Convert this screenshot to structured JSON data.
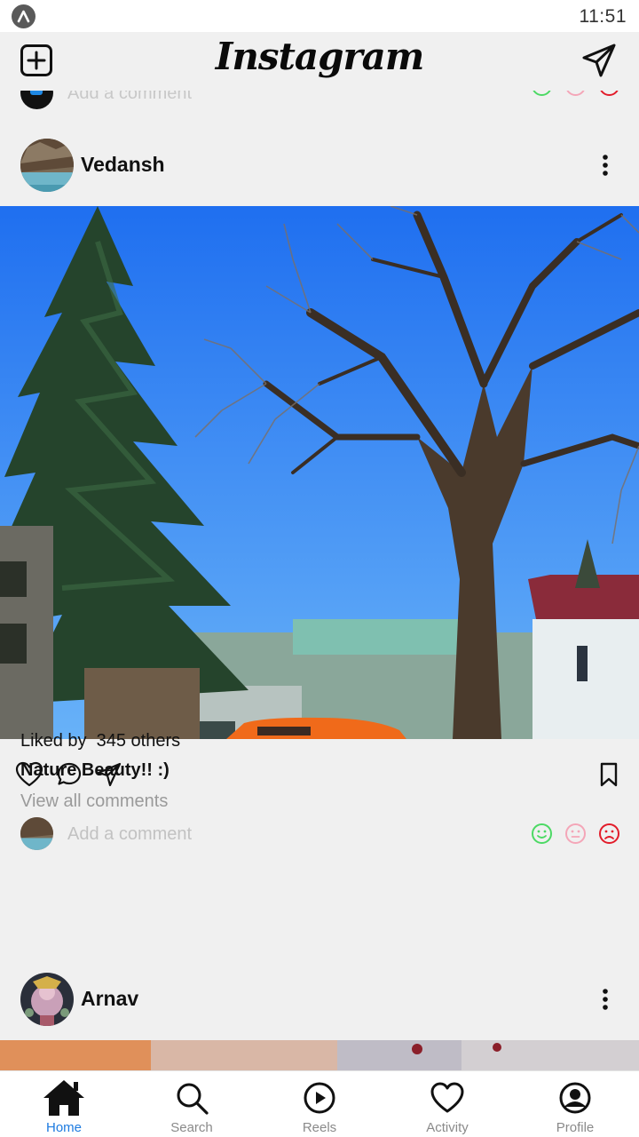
{
  "status_bar": {
    "time": "11:51"
  },
  "header": {
    "title": "Instagram",
    "new_post_icon": "plus-square-icon",
    "direct_icon": "paper-plane-icon"
  },
  "feed": {
    "previous_post": {
      "comment_placeholder": "Add a comment"
    },
    "posts": [
      {
        "username": "Vedansh",
        "likes_label": "Liked by",
        "likes_count": "345 others",
        "caption": "Nature Beauty!! :)",
        "view_comments": "View all comments",
        "comment_placeholder": "Add a comment",
        "reactions": [
          "happy-face-icon",
          "neutral-face-icon",
          "sad-face-icon"
        ]
      },
      {
        "username": "Arnav"
      }
    ]
  },
  "bottom_nav": {
    "items": [
      {
        "label": "Home",
        "icon": "home-icon",
        "active": true
      },
      {
        "label": "Search",
        "icon": "search-icon"
      },
      {
        "label": "Reels",
        "icon": "play-circle-icon"
      },
      {
        "label": "Activity",
        "icon": "heart-icon"
      },
      {
        "label": "Profile",
        "icon": "user-circle-icon"
      }
    ]
  },
  "colors": {
    "active_tab": "#1e7be0",
    "happy": "#4cd964",
    "neutral": "#f4a6b8",
    "sad": "#e21c2a"
  }
}
